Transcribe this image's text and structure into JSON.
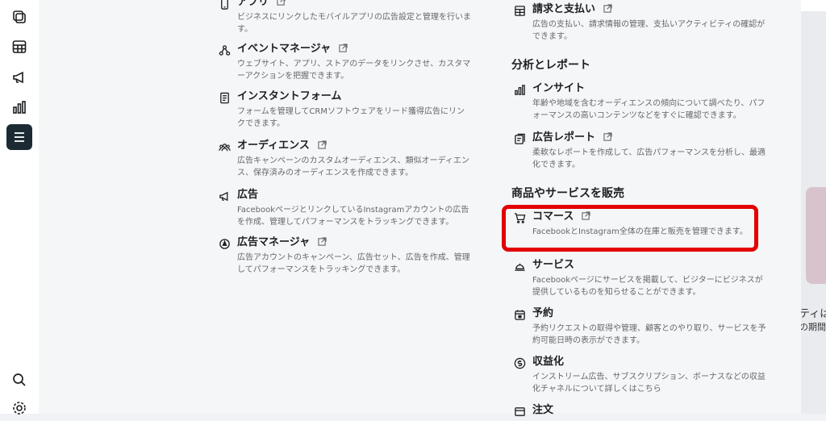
{
  "left_column": [
    {
      "name": "app",
      "icon": "mobile-icon",
      "title": "アプリ",
      "desc": "ビジネスにリンクしたモバイルアプリの広告設定と管理を行います。",
      "external": true
    },
    {
      "name": "event-manager",
      "icon": "nodes-icon",
      "title": "イベントマネージャ",
      "desc": "ウェブサイト、アプリ、ストアのデータをリンクさせ、カスタマーアクションを把握できます。",
      "external": true
    },
    {
      "name": "instant-form",
      "icon": "form-icon",
      "title": "インスタントフォーム",
      "desc": "フォームを管理してCRMソフトウェアをリード獲得広告にリンクできます。",
      "external": false
    },
    {
      "name": "audience",
      "icon": "people-icon",
      "title": "オーディエンス",
      "desc": "広告キャンペーンのカスタムオーディエンス、類似オーディエンス、保存済みのオーディエンスを作成できます。",
      "external": true
    },
    {
      "name": "ads",
      "icon": "megaphone-icon",
      "title": "広告",
      "desc": "FacebookページとリンクしているInstagramアカウントの広告を作成、管理してパフォーマンスをトラッキングできます。",
      "external": false
    },
    {
      "name": "ads-manager",
      "icon": "ads-manager-icon",
      "title": "広告マネージャ",
      "desc": "広告アカウントのキャンペーン、広告セット、広告を作成、管理してパフォーマンスをトラッキングできます。",
      "external": true
    }
  ],
  "right_column": {
    "billing": {
      "icon": "billing-icon",
      "title": "請求と支払い",
      "desc": "広告の支払い、請求情報の管理、支払いアクティビティの確認ができます。",
      "external": true
    },
    "section_analytics": "分析とレポート",
    "analytics_items": [
      {
        "name": "insights",
        "icon": "bar-chart-icon",
        "title": "インサイト",
        "desc": "年齢や地域を含むオーディエンスの傾向について調べたり、パフォーマンスの高いコンテンツなどをすぐに確認できます。",
        "external": false
      },
      {
        "name": "ads-reporting",
        "icon": "report-icon",
        "title": "広告レポート",
        "desc": "柔軟なレポートを作成して、広告パフォーマンスを分析し、最適化できます。",
        "external": true
      }
    ],
    "section_sell": "商品やサービスを販売",
    "sell_items": [
      {
        "name": "commerce",
        "icon": "cart-icon",
        "title": "コマース",
        "desc": "FacebookとInstagram全体の在庫と販売を管理できます。",
        "external": true
      },
      {
        "name": "services",
        "icon": "bell-icon",
        "title": "サービス",
        "desc": "Facebookページにサービスを掲載して、ビジターにビジネスが提供しているものを知らせることができます。",
        "external": false
      },
      {
        "name": "appointments",
        "icon": "calendar-icon",
        "title": "予約",
        "desc": "予約リクエストの取得や管理、顧客とのやり取り、サービスを予約可能日時の表示ができます。",
        "external": false
      },
      {
        "name": "monetization",
        "icon": "dollar-icon",
        "title": "収益化",
        "desc": "インストリーム広告、サブスクリプション、ボーナスなどの収益化チャネルについて詳しくはこちら",
        "external": false
      },
      {
        "name": "orders",
        "icon": "orders-icon",
        "title": "注文",
        "desc": "",
        "external": false
      }
    ]
  },
  "right_strip": {
    "line1": "ティはあ",
    "line2": "の期間"
  },
  "highlight_color": "#e30000"
}
